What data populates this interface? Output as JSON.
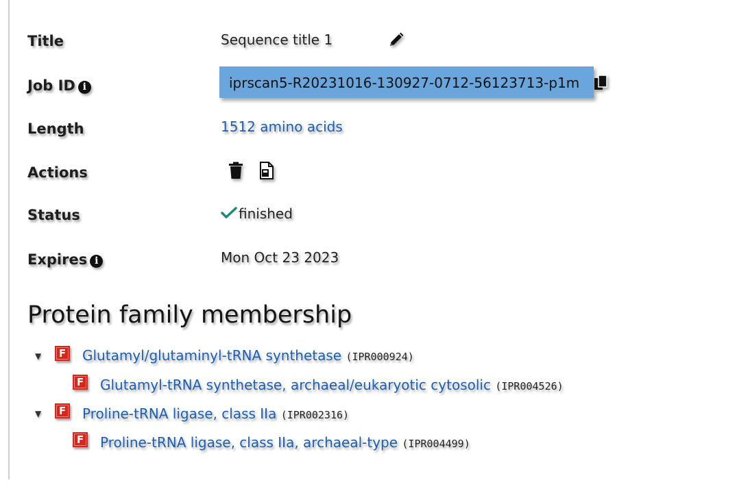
{
  "details": {
    "title_label": "Title",
    "title_value": "Sequence title 1",
    "jobid_label": "Job ID",
    "jobid_value": "iprscan5-R20231016-130927-0712-56123713-p1m",
    "length_label": "Length",
    "length_value": "1512 amino acids",
    "actions_label": "Actions",
    "status_label": "Status",
    "status_value": "finished",
    "expires_label": "Expires",
    "expires_value": "Mon Oct 23 2023"
  },
  "icons": {
    "info": "info-icon",
    "edit": "pencil-icon",
    "copy": "copy-icon",
    "delete": "trash-icon",
    "file": "file-icon",
    "status": "checkmark-icon",
    "expand": "caret-down-icon",
    "family": "family-badge-icon"
  },
  "family": {
    "heading": "Protein family membership",
    "badge_letter": "F",
    "items": [
      {
        "name": "Glutamyl/glutaminyl-tRNA synthetase",
        "accession": "(IPR000924)"
      },
      {
        "name": "Glutamyl-tRNA synthetase, archaeal/eukaryotic cytosolic",
        "accession": "(IPR004526)"
      },
      {
        "name": "Proline-tRNA ligase, class IIa",
        "accession": "(IPR002316)"
      },
      {
        "name": "Proline-tRNA ligase, class IIa, archaeal-type",
        "accession": "(IPR004499)"
      }
    ]
  },
  "colors": {
    "link": "#1a5fb4",
    "jobid_highlight": "#6aa6dc",
    "status_check": "#1a8a7a",
    "family_badge": "#d9261c"
  }
}
